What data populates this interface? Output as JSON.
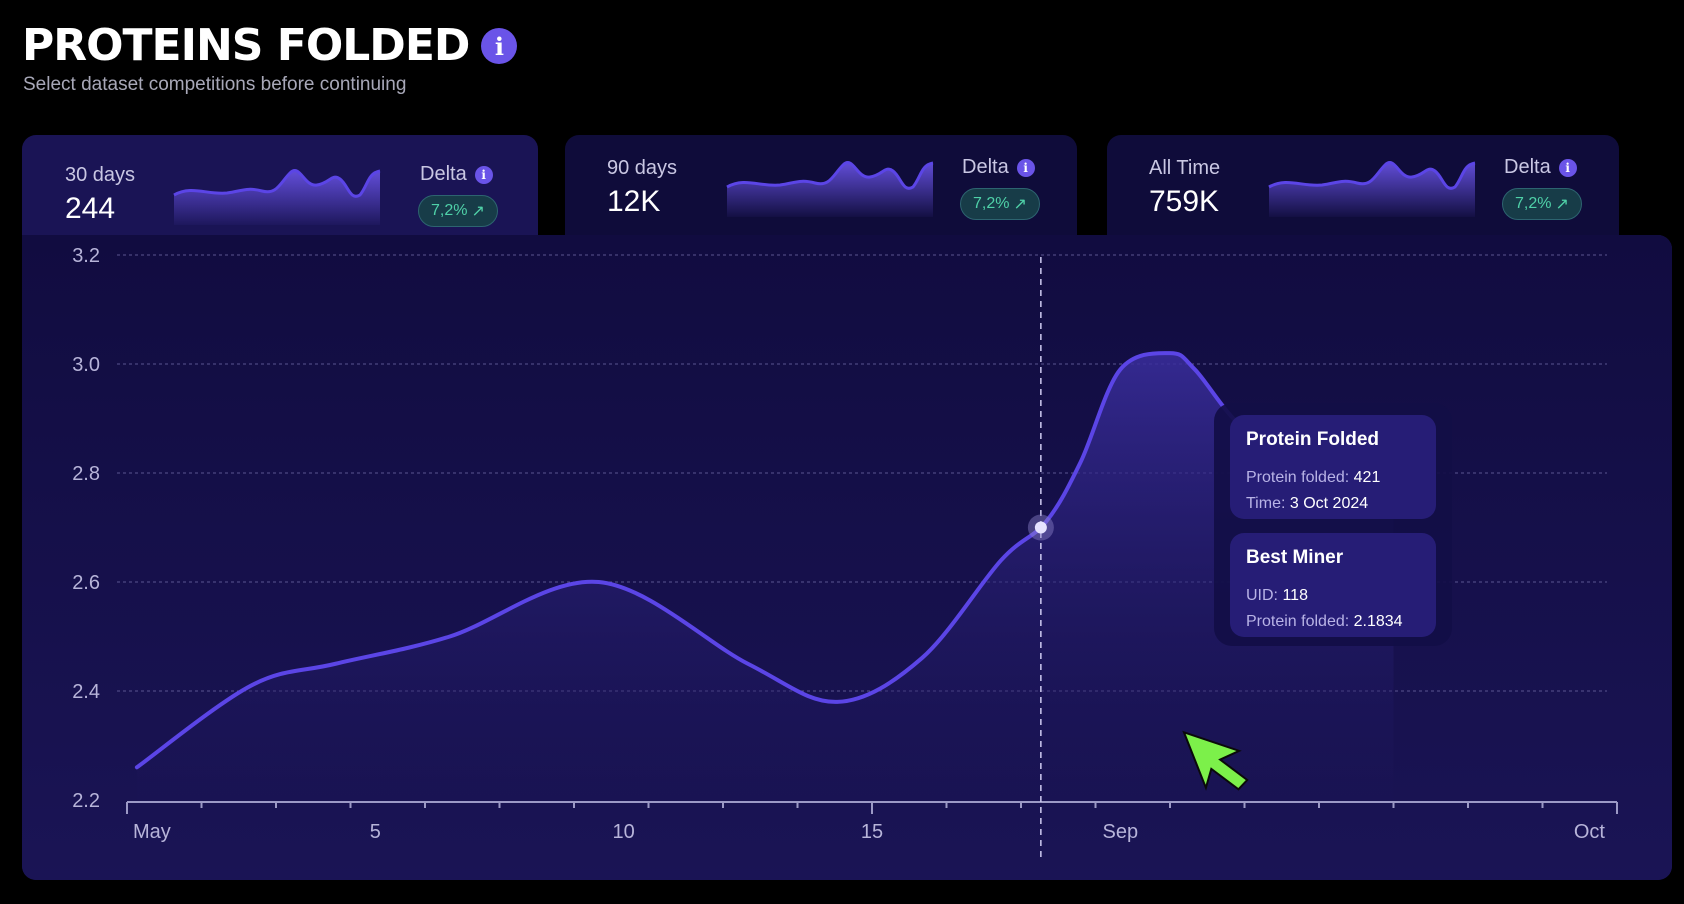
{
  "header": {
    "title": "PROTEINS FOLDED",
    "info_icon": "i",
    "subtitle": "Select dataset competitions before continuing"
  },
  "cards": [
    {
      "label": "30 days",
      "value": "244",
      "delta_label": "Delta",
      "delta_value": "7,2%",
      "active": true
    },
    {
      "label": "90 days",
      "value": "12K",
      "delta_label": "Delta",
      "delta_value": "7,2%",
      "active": false
    },
    {
      "label": "All Time",
      "value": "759K",
      "delta_label": "Delta",
      "delta_value": "7,2%",
      "active": false
    }
  ],
  "tooltip": {
    "section1": {
      "title": "Protein Folded",
      "line1_label": "Protein folded:",
      "line1_value": "421",
      "line2_label": "Time:",
      "line2_value": "3 Oct 2024"
    },
    "section2": {
      "title": "Best Miner",
      "line1_label": "UID:",
      "line1_value": "118",
      "line2_label": "Protein folded:",
      "line2_value": "2.1834"
    }
  },
  "colors": {
    "accent": "#6a54e8",
    "line": "#5b45e6",
    "delta_text": "#4fd1a8",
    "cursor": "#7cf04a"
  },
  "icons": {
    "cursor": "arrow-cursor-icon",
    "info": "info-icon",
    "delta_arrow": "arrow-up-right-icon"
  },
  "chart_data": {
    "type": "area",
    "xlabel": "",
    "ylabel": "",
    "ylim": [
      2.2,
      3.2
    ],
    "yticks": [
      2.2,
      2.4,
      2.6,
      2.8,
      3.0,
      3.2
    ],
    "ytick_labels": [
      "2.2",
      "2.4",
      "2.6",
      "2.8",
      "3.0",
      "3.2"
    ],
    "xrange": [
      0,
      30
    ],
    "xticks": [
      0,
      5,
      10,
      15,
      20,
      25
    ],
    "xtick_labels": [
      "May",
      "5",
      "10",
      "15",
      "Sep",
      "Oct"
    ],
    "grid": true,
    "x": [
      0.2,
      2.5,
      4.2,
      6.5,
      9.5,
      12.5,
      14.3,
      16.0,
      17.6,
      18.5,
      19.2,
      20.0,
      21.0,
      21.5,
      22.5,
      24.0,
      25.5
    ],
    "y": [
      2.26,
      2.41,
      2.45,
      2.5,
      2.6,
      2.45,
      2.38,
      2.46,
      2.64,
      2.71,
      2.82,
      2.99,
      3.02,
      2.99,
      2.88,
      2.8,
      2.82
    ],
    "highlight": {
      "x": 18.4,
      "y": 2.7
    }
  }
}
